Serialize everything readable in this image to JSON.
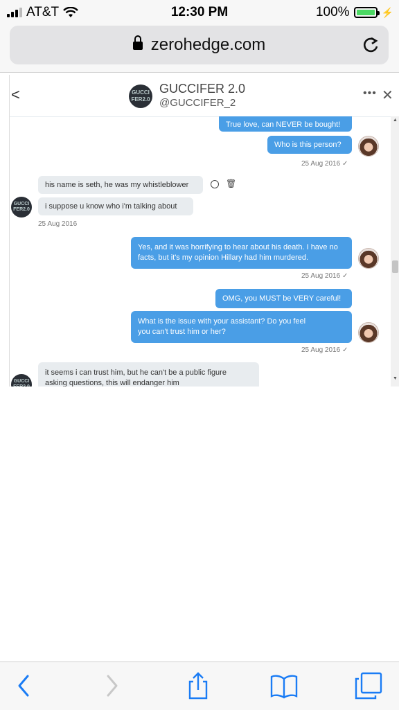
{
  "status_bar": {
    "carrier": "AT&T",
    "time": "12:30 PM",
    "battery": "100%"
  },
  "browser": {
    "url": "zerohedge.com"
  },
  "dm": {
    "header": {
      "name": "GUCCIFER 2.0",
      "handle": "@GUCCIFER_2",
      "avatar_text": "GUCCI FER2.0"
    },
    "messages": [
      {
        "direction": "outgoing",
        "text": "True love, can NEVER be bought!"
      },
      {
        "direction": "outgoing",
        "text": "Who is this person?",
        "time": "25 Aug 2016 ✓"
      },
      {
        "direction": "incoming",
        "text": "his name is seth, he was my whistleblower"
      },
      {
        "direction": "incoming",
        "text": "i suppose u know who i'm talking about",
        "time": "25 Aug 2016"
      },
      {
        "direction": "outgoing",
        "text": "Yes, and it was horrifying to hear about his death. I have no facts, but it's my opinion Hillary had him murdered.",
        "time": "25 Aug 2016 ✓"
      },
      {
        "direction": "outgoing",
        "text": "OMG, you MUST be VERY careful!"
      },
      {
        "direction": "outgoing",
        "text": "What is the issue with your assistant? Do you feel you can't trust him or her?",
        "time": "25 Aug 2016 ✓"
      },
      {
        "direction": "incoming",
        "text": "it seems i can trust him, but he can't be a public figure asking questions, this will endanger him"
      }
    ]
  },
  "icons": {
    "back": "chevron-left-icon",
    "more": "more-icon",
    "close": "close-icon",
    "block": "block-icon",
    "delete": "trash-icon",
    "reload": "reload-icon",
    "share": "share-icon",
    "bookmarks": "bookmarks-icon",
    "tabs": "tabs-icon"
  },
  "colors": {
    "outgoing_bubble": "#4a9ee6",
    "incoming_bubble": "#e8ecef",
    "ios_blue": "#1a7cf5",
    "battery_green": "#4cd964"
  },
  "battery_level": 1.0
}
